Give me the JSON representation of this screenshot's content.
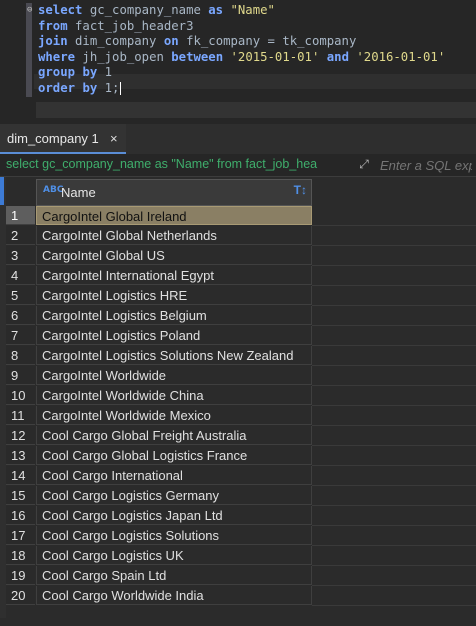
{
  "editor": {
    "lines": [
      [
        {
          "t": "select",
          "k": "kw"
        },
        {
          "t": " gc_company_name ",
          "k": ""
        },
        {
          "t": "as",
          "k": "kw"
        },
        {
          "t": " ",
          "k": ""
        },
        {
          "t": "\"Name\"",
          "k": "str"
        }
      ],
      [
        {
          "t": "from",
          "k": "kw"
        },
        {
          "t": " fact_job_header3",
          "k": ""
        }
      ],
      [
        {
          "t": "join",
          "k": "kw"
        },
        {
          "t": " dim_company ",
          "k": ""
        },
        {
          "t": "on",
          "k": "kw"
        },
        {
          "t": " fk_company = tk_company",
          "k": ""
        }
      ],
      [
        {
          "t": "where",
          "k": "kw"
        },
        {
          "t": " jh_job_open ",
          "k": ""
        },
        {
          "t": "between",
          "k": "kw"
        },
        {
          "t": " ",
          "k": ""
        },
        {
          "t": "'2015-01-01'",
          "k": "str"
        },
        {
          "t": " ",
          "k": ""
        },
        {
          "t": "and",
          "k": "kw"
        },
        {
          "t": " ",
          "k": ""
        },
        {
          "t": "'2016-01-01'",
          "k": "str"
        }
      ],
      [
        {
          "t": "group",
          "k": "kw"
        },
        {
          "t": " ",
          "k": ""
        },
        {
          "t": "by",
          "k": "kw"
        },
        {
          "t": " 1",
          "k": ""
        }
      ],
      [
        {
          "t": "order",
          "k": "kw"
        },
        {
          "t": " ",
          "k": ""
        },
        {
          "t": "by",
          "k": "kw"
        },
        {
          "t": " 1;",
          "k": ""
        }
      ]
    ]
  },
  "tab": {
    "label": "dim_company 1",
    "close": "×"
  },
  "filter": {
    "query_text": "select gc_company_name as \"Name\" from fact_job_hea",
    "input_placeholder": "Enter a SQL exp"
  },
  "grid": {
    "column_header": "Name",
    "type_icon_label": "ABC",
    "selected_row": 1,
    "rows": [
      {
        "n": "1",
        "name": "CargoIntel Global Ireland"
      },
      {
        "n": "2",
        "name": "CargoIntel Global Netherlands"
      },
      {
        "n": "3",
        "name": "CargoIntel Global US"
      },
      {
        "n": "4",
        "name": "CargoIntel International Egypt"
      },
      {
        "n": "5",
        "name": "CargoIntel Logistics HRE"
      },
      {
        "n": "6",
        "name": "CargoIntel Logistics Belgium"
      },
      {
        "n": "7",
        "name": "CargoIntel Logistics Poland"
      },
      {
        "n": "8",
        "name": "CargoIntel Logistics Solutions New Zealand"
      },
      {
        "n": "9",
        "name": "CargoIntel Worldwide"
      },
      {
        "n": "10",
        "name": "CargoIntel Worldwide China"
      },
      {
        "n": "11",
        "name": "CargoIntel Worldwide Mexico"
      },
      {
        "n": "12",
        "name": "Cool Cargo Global Freight Australia"
      },
      {
        "n": "13",
        "name": "Cool Cargo Global Logistics France"
      },
      {
        "n": "14",
        "name": "Cool Cargo International"
      },
      {
        "n": "15",
        "name": "Cool Cargo Logistics Germany"
      },
      {
        "n": "16",
        "name": "Cool Cargo Logistics Japan Ltd"
      },
      {
        "n": "17",
        "name": "Cool Cargo Logistics Solutions"
      },
      {
        "n": "18",
        "name": "Cool Cargo Logistics UK"
      },
      {
        "n": "19",
        "name": "Cool Cargo Spain Ltd"
      },
      {
        "n": "20",
        "name": "Cool Cargo Worldwide India"
      }
    ]
  },
  "colors": {
    "accent": "#3d7bd6",
    "keyword": "#7aa7ff",
    "string": "#e0d98c",
    "selection": "#8a7f64"
  }
}
